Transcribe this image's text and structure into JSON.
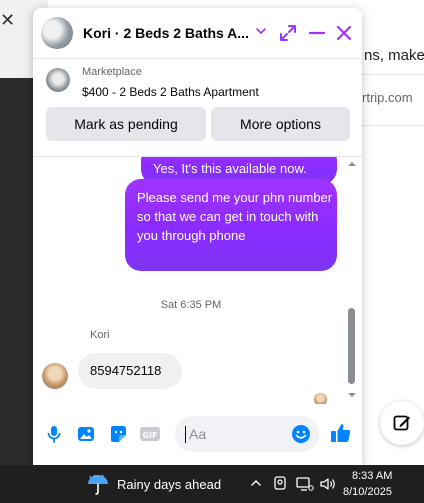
{
  "background": {
    "right_text_line1": "ns, make",
    "right_text_line2": "rtrip.com"
  },
  "chat": {
    "header": {
      "title": "Kori · 2 Beds 2 Baths A...",
      "icons": [
        "chevron-down-icon",
        "expand-icon",
        "minimize-icon",
        "close-icon"
      ]
    },
    "listing": {
      "label": "Marketplace",
      "title": "$400 - 2 Beds 2 Baths Apartment",
      "mark_pending_label": "Mark as pending",
      "more_options_label": "More options"
    },
    "messages": {
      "outgoing_1": "Yes, It's this available now.",
      "outgoing_2": "Please send me your phn number so that we can get in touch with you through phone",
      "timestamp": "Sat 6:35 PM",
      "sender_name": "Kori",
      "incoming_1": "8594752118"
    },
    "composer": {
      "placeholder": "Aa",
      "icons": [
        "microphone-icon",
        "photo-icon",
        "sticker-icon",
        "gif-icon",
        "emoji-icon",
        "thumbs-up-icon"
      ]
    }
  },
  "taskbar": {
    "weather_text": "Rainy days ahead",
    "time": "8:33 AM",
    "date": "8/10/2025"
  },
  "colors": {
    "accent": "#a033ff",
    "messenger_blue": "#0084ff",
    "taskbar": "#1f1f1f"
  }
}
